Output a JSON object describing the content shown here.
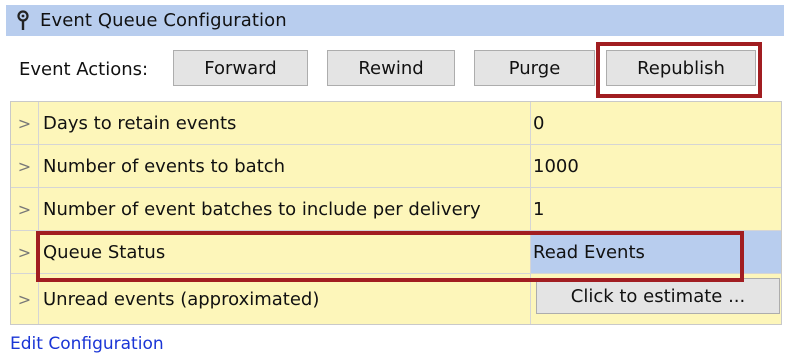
{
  "panel": {
    "title": "Event Queue Configuration",
    "pin_icon": "pin-icon"
  },
  "actions": {
    "label": "Event Actions:",
    "buttons": [
      "Forward",
      "Rewind",
      "Purge",
      "Republish"
    ],
    "highlighted": "Republish"
  },
  "properties": [
    {
      "name": "Days to retain events",
      "value": "0"
    },
    {
      "name": "Number of events to batch",
      "value": "1000"
    },
    {
      "name": "Number of event batches to include per delivery",
      "value": "1"
    },
    {
      "name": "Queue Status",
      "value": "Read Events",
      "selected": true
    },
    {
      "name": "Unread events (approximated)",
      "button": "Click to estimate ..."
    }
  ],
  "footer": {
    "edit_link": "Edit Configuration"
  },
  "colors": {
    "title_bar": "#b8cdee",
    "grid_background": "#fdf6ba",
    "selection": "#b8cdee",
    "highlight_border": "#a11d21",
    "link": "#1a35d6"
  }
}
